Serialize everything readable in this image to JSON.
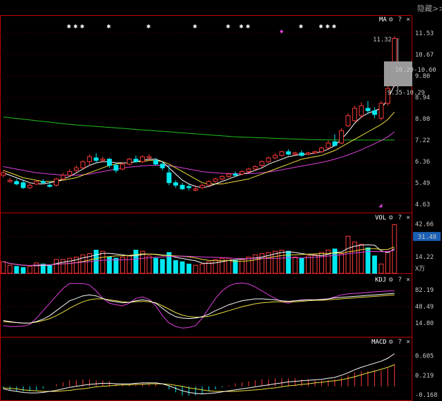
{
  "toolbar": {
    "hide_label": "隐藏>>"
  },
  "colors": {
    "up": "#ff3b3b",
    "down": "#00e8f0",
    "ma5": "#ffffff",
    "ma10": "#f0e040",
    "ma20": "#e040e0",
    "ma250": "#20c020",
    "axis": "#c00000",
    "grid": "#3a0000",
    "macd_dif": "#ffffff",
    "macd_dea": "#f0e040",
    "vol_badge": "#1a5fb4"
  },
  "main_panel": {
    "name": "MA",
    "y_ticks": [
      "11.53",
      "10.67",
      "9.80",
      "8.94",
      "8.08",
      "7.22",
      "6.36",
      "5.49",
      "4.63"
    ],
    "y_range": [
      4.63,
      11.53
    ],
    "annotations": {
      "last_price": "11.32",
      "range_upper": "10.29-10.60",
      "range_lower": "9.35-10.29"
    },
    "star_columns": [
      10,
      11,
      12,
      16,
      22,
      29,
      34,
      36,
      37,
      45,
      48,
      49,
      50
    ],
    "pink_marker_col": 42
  },
  "vol_panel": {
    "name": "VOL",
    "y_ticks": [
      "42.66",
      "31.48",
      "14.22"
    ],
    "highlight_value": "31.48",
    "unit": "X万",
    "y_range": [
      0,
      50
    ]
  },
  "kdj_panel": {
    "name": "KDJ",
    "y_ticks": [
      "82.19",
      "48.49",
      "14.80"
    ],
    "y_range": [
      -10,
      110
    ]
  },
  "macd_panel": {
    "name": "MACD",
    "y_ticks": [
      "0.605",
      "0.219",
      "-0.168"
    ],
    "y_range": [
      -0.25,
      0.82
    ]
  },
  "chart_data": [
    {
      "type": "candlestick",
      "title": "MA",
      "ylim": [
        4.63,
        11.53
      ],
      "candles": [
        [
          5.9,
          6.0,
          5.8,
          5.7,
          1
        ],
        [
          5.6,
          5.7,
          5.55,
          5.5,
          1
        ],
        [
          5.55,
          5.65,
          5.45,
          5.4,
          0
        ],
        [
          5.5,
          5.6,
          5.3,
          5.25,
          0
        ],
        [
          5.3,
          5.5,
          5.4,
          5.25,
          1
        ],
        [
          5.45,
          5.6,
          5.55,
          5.4,
          1
        ],
        [
          5.55,
          5.65,
          5.5,
          5.45,
          0
        ],
        [
          5.4,
          5.55,
          5.35,
          5.3,
          0
        ],
        [
          5.4,
          5.7,
          5.65,
          5.35,
          1
        ],
        [
          5.65,
          5.9,
          5.8,
          5.6,
          1
        ],
        [
          5.8,
          6.05,
          5.95,
          5.75,
          1
        ],
        [
          6.0,
          6.2,
          6.1,
          5.9,
          1
        ],
        [
          6.1,
          6.4,
          6.35,
          6.05,
          1
        ],
        [
          6.35,
          6.65,
          6.55,
          6.2,
          1
        ],
        [
          6.5,
          6.7,
          6.4,
          6.3,
          0
        ],
        [
          6.4,
          6.55,
          6.45,
          6.35,
          1
        ],
        [
          6.45,
          6.5,
          6.2,
          6.1,
          0
        ],
        [
          6.2,
          6.3,
          6.0,
          5.9,
          0
        ],
        [
          6.05,
          6.3,
          6.25,
          6.0,
          1
        ],
        [
          6.25,
          6.5,
          6.45,
          6.2,
          1
        ],
        [
          6.45,
          6.6,
          6.35,
          6.3,
          0
        ],
        [
          6.35,
          6.6,
          6.55,
          6.3,
          1
        ],
        [
          6.55,
          6.65,
          6.5,
          6.4,
          1
        ],
        [
          6.4,
          6.5,
          6.25,
          6.2,
          0
        ],
        [
          6.25,
          6.35,
          6.1,
          6.0,
          0
        ],
        [
          5.9,
          6.2,
          5.5,
          5.4,
          0
        ],
        [
          5.5,
          5.6,
          5.4,
          5.3,
          0
        ],
        [
          5.4,
          5.5,
          5.25,
          5.2,
          0
        ],
        [
          5.35,
          5.45,
          5.3,
          5.2,
          0
        ],
        [
          5.2,
          5.4,
          5.25,
          5.15,
          1
        ],
        [
          5.3,
          5.45,
          5.4,
          5.25,
          1
        ],
        [
          5.4,
          5.6,
          5.55,
          5.35,
          1
        ],
        [
          5.55,
          5.7,
          5.65,
          5.5,
          1
        ],
        [
          5.65,
          5.8,
          5.75,
          5.6,
          1
        ],
        [
          5.75,
          5.9,
          5.85,
          5.7,
          1
        ],
        [
          5.85,
          5.95,
          5.8,
          5.75,
          0
        ],
        [
          5.85,
          6.0,
          5.95,
          5.8,
          1
        ],
        [
          5.95,
          6.1,
          6.05,
          5.9,
          1
        ],
        [
          6.05,
          6.2,
          6.15,
          6.0,
          1
        ],
        [
          6.2,
          6.4,
          6.35,
          6.1,
          1
        ],
        [
          6.35,
          6.55,
          6.5,
          6.3,
          1
        ],
        [
          6.5,
          6.7,
          6.6,
          6.45,
          1
        ],
        [
          6.6,
          6.8,
          6.75,
          6.55,
          1
        ],
        [
          6.75,
          6.85,
          6.65,
          6.6,
          0
        ],
        [
          6.65,
          6.75,
          6.7,
          6.6,
          1
        ],
        [
          6.7,
          6.8,
          6.6,
          6.55,
          0
        ],
        [
          6.65,
          6.75,
          6.7,
          6.6,
          1
        ],
        [
          6.7,
          6.8,
          6.75,
          6.65,
          1
        ],
        [
          6.75,
          6.95,
          6.9,
          6.7,
          1
        ],
        [
          6.9,
          7.2,
          7.1,
          6.85,
          1
        ],
        [
          7.15,
          7.45,
          7.0,
          6.95,
          0
        ],
        [
          7.1,
          7.7,
          7.6,
          7.05,
          1
        ],
        [
          7.8,
          8.3,
          8.2,
          7.75,
          1
        ],
        [
          8.0,
          8.6,
          8.5,
          7.95,
          1
        ],
        [
          8.2,
          8.75,
          8.6,
          8.1,
          1
        ],
        [
          8.5,
          8.8,
          8.4,
          8.3,
          0
        ],
        [
          8.4,
          8.55,
          8.25,
          8.1,
          0
        ],
        [
          8.1,
          8.8,
          8.7,
          8.0,
          1
        ],
        [
          8.7,
          9.4,
          9.3,
          8.6,
          1
        ],
        [
          9.8,
          11.4,
          11.32,
          9.35,
          1
        ]
      ],
      "ma5": [
        5.9,
        5.8,
        5.7,
        5.6,
        5.5,
        5.45,
        5.45,
        5.5,
        5.55,
        5.65,
        5.75,
        5.9,
        6.05,
        6.2,
        6.3,
        6.35,
        6.35,
        6.3,
        6.3,
        6.3,
        6.35,
        6.4,
        6.45,
        6.45,
        6.35,
        6.1,
        5.85,
        5.6,
        5.45,
        5.35,
        5.3,
        5.35,
        5.45,
        5.55,
        5.65,
        5.75,
        5.85,
        5.9,
        6.0,
        6.1,
        6.25,
        6.35,
        6.45,
        6.55,
        6.6,
        6.65,
        6.65,
        6.7,
        6.75,
        6.85,
        7.0,
        7.25,
        7.55,
        7.9,
        8.15,
        8.3,
        8.4,
        8.5,
        8.85,
        9.45
      ],
      "ma10": [
        6.0,
        5.9,
        5.8,
        5.7,
        5.65,
        5.6,
        5.55,
        5.55,
        5.55,
        5.6,
        5.65,
        5.7,
        5.8,
        5.9,
        6.0,
        6.1,
        6.2,
        6.25,
        6.3,
        6.3,
        6.35,
        6.35,
        6.4,
        6.4,
        6.35,
        6.25,
        6.1,
        5.95,
        5.8,
        5.65,
        5.5,
        5.45,
        5.45,
        5.45,
        5.5,
        5.55,
        5.6,
        5.65,
        5.75,
        5.85,
        5.95,
        6.05,
        6.15,
        6.25,
        6.35,
        6.45,
        6.5,
        6.55,
        6.6,
        6.7,
        6.8,
        6.95,
        7.1,
        7.25,
        7.4,
        7.55,
        7.7,
        7.85,
        8.05,
        8.35
      ],
      "ma20": [
        6.15,
        6.1,
        6.05,
        6.0,
        5.95,
        5.9,
        5.88,
        5.85,
        5.83,
        5.8,
        5.8,
        5.8,
        5.82,
        5.85,
        5.9,
        5.95,
        6.0,
        6.05,
        6.1,
        6.13,
        6.15,
        6.18,
        6.2,
        6.2,
        6.2,
        6.18,
        6.15,
        6.1,
        6.05,
        6.0,
        5.95,
        5.92,
        5.9,
        5.88,
        5.87,
        5.86,
        5.86,
        5.87,
        5.88,
        5.9,
        5.93,
        5.97,
        6.02,
        6.07,
        6.12,
        6.17,
        6.22,
        6.27,
        6.32,
        6.38,
        6.45,
        6.53,
        6.62,
        6.72,
        6.83,
        6.95,
        7.07,
        7.2,
        7.35,
        7.55
      ],
      "ma250": [
        8.15,
        8.12,
        8.09,
        8.06,
        8.03,
        8.0,
        7.97,
        7.94,
        7.91,
        7.88,
        7.85,
        7.83,
        7.81,
        7.79,
        7.77,
        7.75,
        7.73,
        7.71,
        7.69,
        7.67,
        7.65,
        7.63,
        7.61,
        7.59,
        7.57,
        7.55,
        7.53,
        7.51,
        7.49,
        7.47,
        7.45,
        7.43,
        7.41,
        7.39,
        7.37,
        7.35,
        7.34,
        7.33,
        7.32,
        7.31,
        7.3,
        7.29,
        7.28,
        7.27,
        7.26,
        7.25,
        7.24,
        7.24,
        7.23,
        7.23,
        7.22,
        7.22,
        7.22,
        7.22,
        7.22,
        7.22,
        7.22,
        7.22,
        7.22,
        7.22
      ]
    },
    {
      "type": "bar",
      "title": "VOL",
      "ylim": [
        0,
        50
      ],
      "volume": [
        10,
        7,
        6,
        5,
        6,
        9,
        8,
        7,
        12,
        12,
        13,
        14,
        16,
        17,
        20,
        19,
        14,
        13,
        14,
        15,
        20,
        19,
        15,
        13,
        12,
        18,
        11,
        10,
        8,
        7,
        8,
        10,
        12,
        13,
        13,
        11,
        12,
        14,
        16,
        17,
        18,
        19,
        20,
        19,
        14,
        13,
        15,
        16,
        18,
        20,
        21,
        17,
        32,
        27,
        25,
        22,
        15,
        8,
        19,
        42
      ]
    },
    {
      "type": "line",
      "title": "KDJ",
      "ylim": [
        -10,
        110
      ],
      "k": [
        20,
        18,
        16,
        15,
        15,
        18,
        23,
        30,
        40,
        50,
        60,
        65,
        70,
        72,
        70,
        65,
        60,
        58,
        56,
        57,
        60,
        62,
        60,
        55,
        45,
        35,
        28,
        25,
        24,
        25,
        28,
        33,
        40,
        46,
        52,
        56,
        60,
        62,
        64,
        64,
        63,
        62,
        60,
        59,
        60,
        61,
        62,
        62,
        63,
        64,
        66,
        67,
        68,
        69,
        70,
        71,
        72,
        73,
        74,
        75
      ],
      "d": [
        18,
        17,
        16,
        15,
        15,
        17,
        20,
        24,
        30,
        37,
        45,
        52,
        58,
        62,
        64,
        64,
        62,
        60,
        58,
        57,
        58,
        59,
        58,
        56,
        50,
        43,
        36,
        31,
        28,
        27,
        27,
        29,
        32,
        36,
        40,
        44,
        48,
        51,
        54,
        56,
        57,
        58,
        58,
        58,
        58,
        59,
        60,
        61,
        61,
        62,
        63,
        64,
        65,
        66,
        67,
        68,
        69,
        70,
        71,
        72
      ],
      "j": [
        10,
        8,
        8,
        9,
        12,
        25,
        40,
        55,
        70,
        85,
        95,
        95,
        95,
        92,
        80,
        65,
        55,
        52,
        50,
        55,
        65,
        68,
        63,
        50,
        30,
        15,
        8,
        5,
        6,
        10,
        25,
        45,
        65,
        80,
        90,
        95,
        96,
        94,
        88,
        80,
        72,
        65,
        58,
        55,
        60,
        62,
        62,
        61,
        62,
        64,
        68,
        72,
        74,
        75,
        76,
        77,
        78,
        79,
        80,
        80
      ]
    },
    {
      "type": "bar",
      "title": "MACD",
      "ylim": [
        -0.25,
        0.82
      ],
      "dif": [
        -0.05,
        -0.08,
        -0.1,
        -0.12,
        -0.13,
        -0.13,
        -0.12,
        -0.1,
        -0.08,
        -0.05,
        -0.02,
        0.0,
        0.02,
        0.04,
        0.05,
        0.06,
        0.06,
        0.05,
        0.05,
        0.05,
        0.06,
        0.07,
        0.07,
        0.07,
        0.05,
        0.01,
        -0.04,
        -0.09,
        -0.12,
        -0.14,
        -0.15,
        -0.14,
        -0.13,
        -0.11,
        -0.09,
        -0.07,
        -0.05,
        -0.03,
        -0.01,
        0.01,
        0.03,
        0.05,
        0.07,
        0.09,
        0.1,
        0.11,
        0.12,
        0.13,
        0.14,
        0.16,
        0.18,
        0.22,
        0.27,
        0.33,
        0.38,
        0.42,
        0.46,
        0.5,
        0.56,
        0.65
      ],
      "dea": [
        -0.03,
        -0.04,
        -0.05,
        -0.07,
        -0.08,
        -0.09,
        -0.1,
        -0.1,
        -0.1,
        -0.09,
        -0.08,
        -0.06,
        -0.05,
        -0.03,
        -0.01,
        0.0,
        0.01,
        0.02,
        0.03,
        0.03,
        0.04,
        0.04,
        0.05,
        0.05,
        0.05,
        0.04,
        0.02,
        0.0,
        -0.03,
        -0.05,
        -0.07,
        -0.09,
        -0.1,
        -0.1,
        -0.1,
        -0.1,
        -0.09,
        -0.08,
        -0.07,
        -0.06,
        -0.04,
        -0.03,
        -0.01,
        0.01,
        0.02,
        0.04,
        0.05,
        0.07,
        0.08,
        0.1,
        0.11,
        0.13,
        0.16,
        0.19,
        0.23,
        0.27,
        0.3,
        0.34,
        0.38,
        0.43
      ],
      "histogram": [
        -0.04,
        -0.08,
        -0.1,
        -0.1,
        -0.1,
        -0.08,
        -0.04,
        0.0,
        0.04,
        0.08,
        0.12,
        0.12,
        0.14,
        0.14,
        0.12,
        0.12,
        0.1,
        0.06,
        0.04,
        0.04,
        0.04,
        0.06,
        0.04,
        0.04,
        0.0,
        -0.06,
        -0.12,
        -0.18,
        -0.18,
        -0.18,
        -0.16,
        -0.1,
        -0.06,
        -0.02,
        0.02,
        0.06,
        0.08,
        0.1,
        0.12,
        0.14,
        0.14,
        0.16,
        0.16,
        0.16,
        0.16,
        0.14,
        0.14,
        0.12,
        0.12,
        0.12,
        0.14,
        0.18,
        0.22,
        0.28,
        0.3,
        0.3,
        0.32,
        0.32,
        0.36,
        0.44
      ]
    }
  ]
}
